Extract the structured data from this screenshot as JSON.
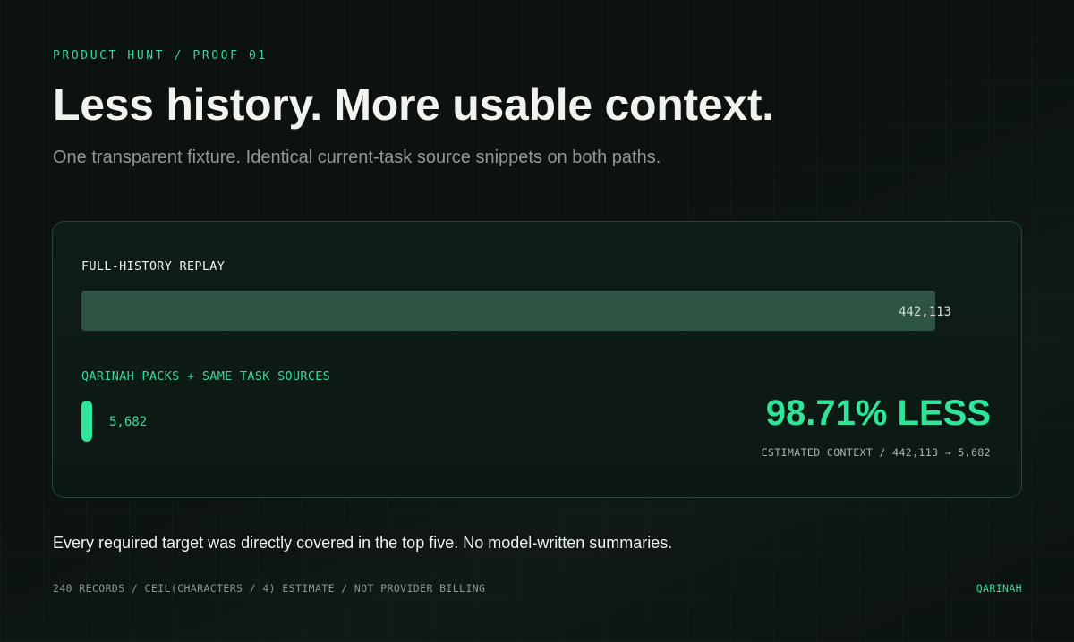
{
  "eyebrow": "PRODUCT HUNT / PROOF 01",
  "headline": "Less history. More usable context.",
  "subhead": "One transparent fixture. Identical current-task source snippets on both paths.",
  "comparison": {
    "full_history": {
      "label": "FULL-HISTORY REPLAY",
      "value": 442113,
      "value_text": "442,113"
    },
    "qarinah": {
      "label": "QARINAH PACKS + SAME TASK SOURCES",
      "value": 5682,
      "value_text": "5,682"
    },
    "reduction": "98.71% LESS",
    "caption": "ESTIMATED CONTEXT / 442,113 → 5,682"
  },
  "summary": "Every required target was directly covered in the top five. No model-written summaries.",
  "footer": {
    "method": "240 RECORDS / CEIL(CHARACTERS / 4) ESTIMATE / NOT PROVIDER BILLING",
    "brand": "QARINAH"
  },
  "colors": {
    "accent": "#2ee59a",
    "accent_text": "#35d99a",
    "full_bar": "#2e5444",
    "background": "#0b120f",
    "card_border": "#28473a"
  }
}
